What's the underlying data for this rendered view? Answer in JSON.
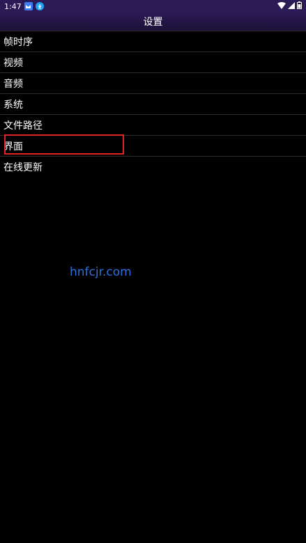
{
  "status_bar": {
    "time": "1:47",
    "notification_icons": [
      "app-notification-icon",
      "download-notification-icon"
    ],
    "system_icons": [
      "wifi-icon",
      "cell-signal-icon",
      "battery-icon"
    ]
  },
  "header": {
    "title": "设置"
  },
  "menu": {
    "items": [
      {
        "label": "帧时序"
      },
      {
        "label": "视频"
      },
      {
        "label": "音频"
      },
      {
        "label": "系统"
      },
      {
        "label": "文件路径"
      },
      {
        "label": "界面"
      },
      {
        "label": "在线更新"
      }
    ],
    "highlighted_index": 5
  },
  "watermark": {
    "text": "hnfcjr.com"
  },
  "colors": {
    "background": "#000000",
    "status_bar": "#2a1a55",
    "divider": "#2b2b2b",
    "highlight": "#e12323",
    "watermark": "#2f6fe0"
  }
}
